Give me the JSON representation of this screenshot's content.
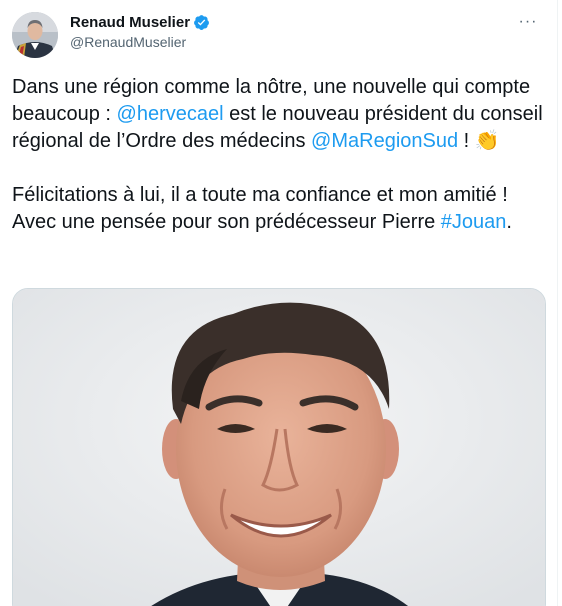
{
  "tweet": {
    "author": {
      "display_name": "Renaud Muselier",
      "handle": "@RenaudMuselier",
      "verified_icon": "verified-badge-icon",
      "avatar_icon": "avatar-photo"
    },
    "more_label": "···",
    "paragraph1": {
      "t1": "Dans une région comme la nôtre, une nouvelle qui compte beaucoup : ",
      "mention1": "@hervecael",
      "t2": " est le nouveau président du conseil régional de l’Ordre des médecins ",
      "mention2": "@MaRegionSud",
      "t3": " ! ",
      "emoji": "👏"
    },
    "paragraph2": {
      "t1": "Félicitations à lui, il a toute ma confiance et mon amitié ! Avec une pensée pour son prédécesseur Pierre ",
      "hashtag": "#Jouan",
      "t2": "."
    },
    "media": {
      "description_icon": "portrait-photo"
    }
  },
  "colors": {
    "link": "#1d9bf0",
    "text": "#0f1419",
    "secondary": "#536471",
    "border": "#cfd9de"
  }
}
